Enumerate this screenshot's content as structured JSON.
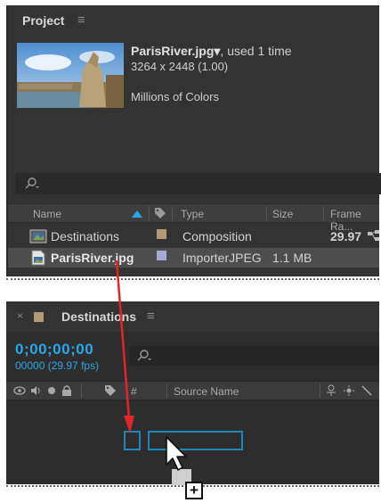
{
  "project": {
    "title": "Project",
    "menu_icon": "hamburger-menu-icon",
    "selected_item": {
      "name": "ParisRiver.jpg",
      "dropdown_glyph": "▾",
      "usage": ", used 1 time",
      "dimensions": "3264 x 2448 (1.00)",
      "colors": "Millions of Colors"
    },
    "search": {
      "value": "",
      "icon": "search-icon"
    },
    "columns": {
      "name": "Name",
      "type": "Type",
      "size": "Size",
      "frame_rate": "Frame Ra..."
    },
    "items": [
      {
        "name": "Destinations",
        "type": "Composition",
        "size": "",
        "frame_rate": "29.97",
        "icon": "composition-icon",
        "label_color": "#b49a74"
      },
      {
        "name": "ParisRiver.jpg",
        "type": "ImporterJPEG",
        "size": "1.1 MB",
        "frame_rate": "",
        "icon": "image-file-icon",
        "label_color": "#a7a9d8"
      }
    ]
  },
  "timeline": {
    "title": "Destinations",
    "close_glyph": "×",
    "menu_icon": "hamburger-menu-icon",
    "current_time": "0;00;00;00",
    "frames_fps": "00000 (29.97 fps)",
    "search": {
      "value": "",
      "icon": "search-icon"
    },
    "columns": {
      "source_name": "Source Name",
      "hash": "#"
    },
    "accent_color": "#2aa8e6"
  },
  "drag": {
    "plus_glyph": "+",
    "arrow_color": "#e0262b"
  }
}
